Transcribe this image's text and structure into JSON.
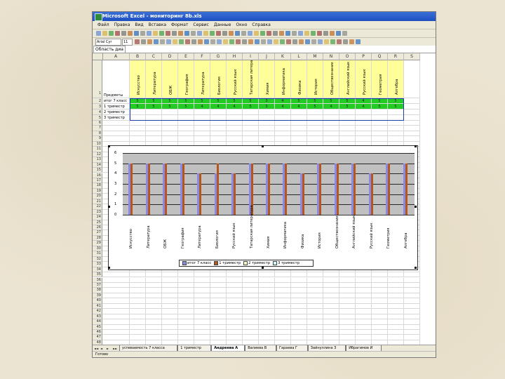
{
  "window": {
    "title": "Microsoft Excel - мониторинг 8b.xls"
  },
  "menu": [
    "Файл",
    "Правка",
    "Вид",
    "Вставка",
    "Формат",
    "Сервис",
    "Данные",
    "Окно",
    "Справка"
  ],
  "toolbar": {
    "font_name": "Arial Cyr",
    "font_size": "11"
  },
  "name_box": "Область диа",
  "columns": [
    "A",
    "B",
    "C",
    "D",
    "E",
    "F",
    "G",
    "H",
    "I",
    "J",
    "K",
    "L",
    "M",
    "N",
    "O",
    "P",
    "Q",
    "R",
    "S"
  ],
  "subjects": [
    "Искусство",
    "Литература",
    "ОБЖ",
    "География",
    "Литература",
    "Биология",
    "Русский язык",
    "Татарская литература",
    "Химия",
    "Информатика",
    "Физика",
    "История",
    "Обществознание",
    "Английский язык",
    "Русский язык",
    "Геометрия",
    "Алгебра"
  ],
  "rows": [
    {
      "label": "Предметы",
      "values": []
    },
    {
      "label": "итог 7 класс",
      "values": [
        "5",
        "5",
        "5",
        "5",
        "5",
        "5",
        "5",
        "5",
        "3",
        "4",
        "5",
        "5",
        "5",
        "5",
        "4",
        "5",
        "5"
      ]
    },
    {
      "label": "1 триместр",
      "values": [
        "5",
        "5",
        "5",
        "5",
        "4",
        "4",
        "4",
        "5",
        "3",
        "4",
        "4",
        "5",
        "4",
        "5",
        "4",
        "5",
        "5"
      ]
    },
    {
      "label": "2 триместр",
      "values": []
    },
    {
      "label": "3 триместр",
      "values": []
    }
  ],
  "chart_data": {
    "type": "bar",
    "categories": [
      "Искусство",
      "Литература",
      "ОБЖ",
      "География",
      "Литература",
      "Биология",
      "Русский язык",
      "Татарская литература",
      "Химия",
      "Информатика",
      "Физика",
      "История",
      "Обществознание",
      "Английский язык",
      "Русский язык",
      "Геометрия",
      "Алгебра"
    ],
    "series": [
      {
        "name": "итог 7 класс",
        "color": "#8a8ae6",
        "values": [
          5,
          5,
          5,
          5,
          4,
          4,
          4,
          5,
          5,
          5,
          4,
          5,
          5,
          5,
          4,
          5,
          5
        ]
      },
      {
        "name": "1 триместр",
        "color": "#b5561c",
        "values": [
          5,
          5,
          5,
          5,
          4,
          5,
          4,
          5,
          5,
          5,
          4,
          5,
          5,
          5,
          4,
          5,
          5
        ]
      },
      {
        "name": "2 триместр",
        "color": "#ffffcc",
        "values": [
          0,
          0,
          0,
          0,
          0,
          0,
          0,
          0,
          0,
          0,
          0,
          0,
          0,
          0,
          0,
          0,
          0
        ]
      },
      {
        "name": "3 триместр",
        "color": "#ccffff",
        "values": [
          0,
          0,
          0,
          0,
          0,
          0,
          0,
          0,
          0,
          0,
          0,
          0,
          0,
          0,
          0,
          0,
          0
        ]
      }
    ],
    "ylim": [
      0,
      6
    ],
    "yticks": [
      "0",
      "1",
      "2",
      "3",
      "4",
      "5",
      "6"
    ],
    "grid": true,
    "legend_position": "bottom"
  },
  "sheet_tabs": [
    "успеваемость 7 класса",
    "1 триместр",
    "Андреева А",
    "Валиева В",
    "Гараева Г",
    "Зайнуллина З",
    "Ибрагимов И"
  ],
  "active_tab_index": 2,
  "status": "Готово"
}
